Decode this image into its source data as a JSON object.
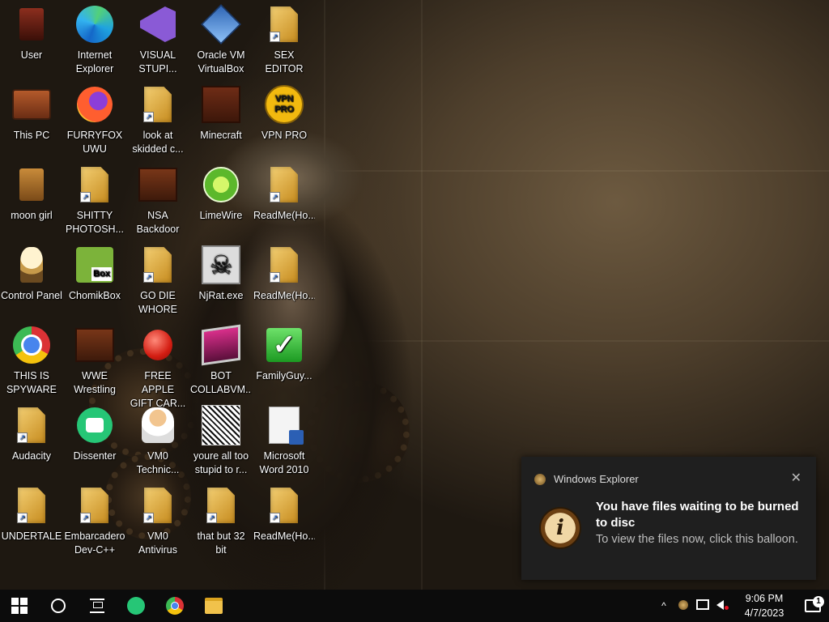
{
  "desktop": {
    "icons": [
      {
        "label": "User",
        "icon": "user-folder-icon"
      },
      {
        "label": "Internet\nExplorer",
        "icon": "edge-icon"
      },
      {
        "label": "VISUAL\nSTUPI...",
        "icon": "visual-studio-icon"
      },
      {
        "label": "Oracle VM\nVirtualBox",
        "icon": "virtualbox-icon"
      },
      {
        "label": "SEX\nEDITOR",
        "icon": "file-icon"
      },
      {
        "label": "This PC",
        "icon": "computer-icon"
      },
      {
        "label": "FURRYFOX\nUWU",
        "icon": "firefox-icon"
      },
      {
        "label": "look at\nskidded c...",
        "icon": "file-icon"
      },
      {
        "label": "Minecraft",
        "icon": "minecraft-icon"
      },
      {
        "label": "VPN PRO",
        "icon": "vpn-icon"
      },
      {
        "label": "moon girl",
        "icon": "folder-icon"
      },
      {
        "label": "SHITTY\nPHOTOSH...",
        "icon": "file-icon"
      },
      {
        "label": "NSA\nBackdoor",
        "icon": "nsa-icon"
      },
      {
        "label": "LimeWire",
        "icon": "limewire-icon"
      },
      {
        "label": "ReadMe(Ho...",
        "icon": "file-icon"
      },
      {
        "label": "Control Panel",
        "icon": "control-panel-icon"
      },
      {
        "label": "ChomikBox",
        "icon": "chomikbox-icon"
      },
      {
        "label": "GO DIE\nWHORE",
        "icon": "file-icon"
      },
      {
        "label": "NjRat.exe",
        "icon": "skull-icon"
      },
      {
        "label": "ReadMe(Ho...",
        "icon": "file-icon"
      },
      {
        "label": "THIS IS\nSPYWARE",
        "icon": "chrome-icon"
      },
      {
        "label": "WWE\nWrestling",
        "icon": "wwe-icon"
      },
      {
        "label": "FREE APPLE\nGIFT CAR...",
        "icon": "apple-icon"
      },
      {
        "label": "BOT\nCOLLABVM...",
        "icon": "bot-icon"
      },
      {
        "label": "FamilyGuy...",
        "icon": "checkmark-icon"
      },
      {
        "label": "Audacity",
        "icon": "file-icon"
      },
      {
        "label": "Dissenter",
        "icon": "dissenter-icon"
      },
      {
        "label": "VM0\nTechnic...",
        "icon": "technician-icon"
      },
      {
        "label": "youre all too\nstupid to r...",
        "icon": "face-image-icon"
      },
      {
        "label": "Microsoft\nWord 2010",
        "icon": "word-icon"
      },
      {
        "label": "UNDERTALE",
        "icon": "file-icon"
      },
      {
        "label": "Embarcadero\nDev-C++",
        "icon": "file-icon"
      },
      {
        "label": "VM0\nAntivirus",
        "icon": "file-icon"
      },
      {
        "label": "that but 32\nbit",
        "icon": "file-icon"
      },
      {
        "label": "ReadMe(Ho...",
        "icon": "file-icon"
      }
    ]
  },
  "toast": {
    "app_name": "Windows Explorer",
    "close": "✕",
    "big_icon": "i",
    "title": "You have files waiting to be burned to disc",
    "body": "To view the files now, click this balloon."
  },
  "taskbar": {
    "time": "9:06 PM",
    "date": "4/7/2023",
    "tray_up": "^",
    "notif_count": "1"
  }
}
